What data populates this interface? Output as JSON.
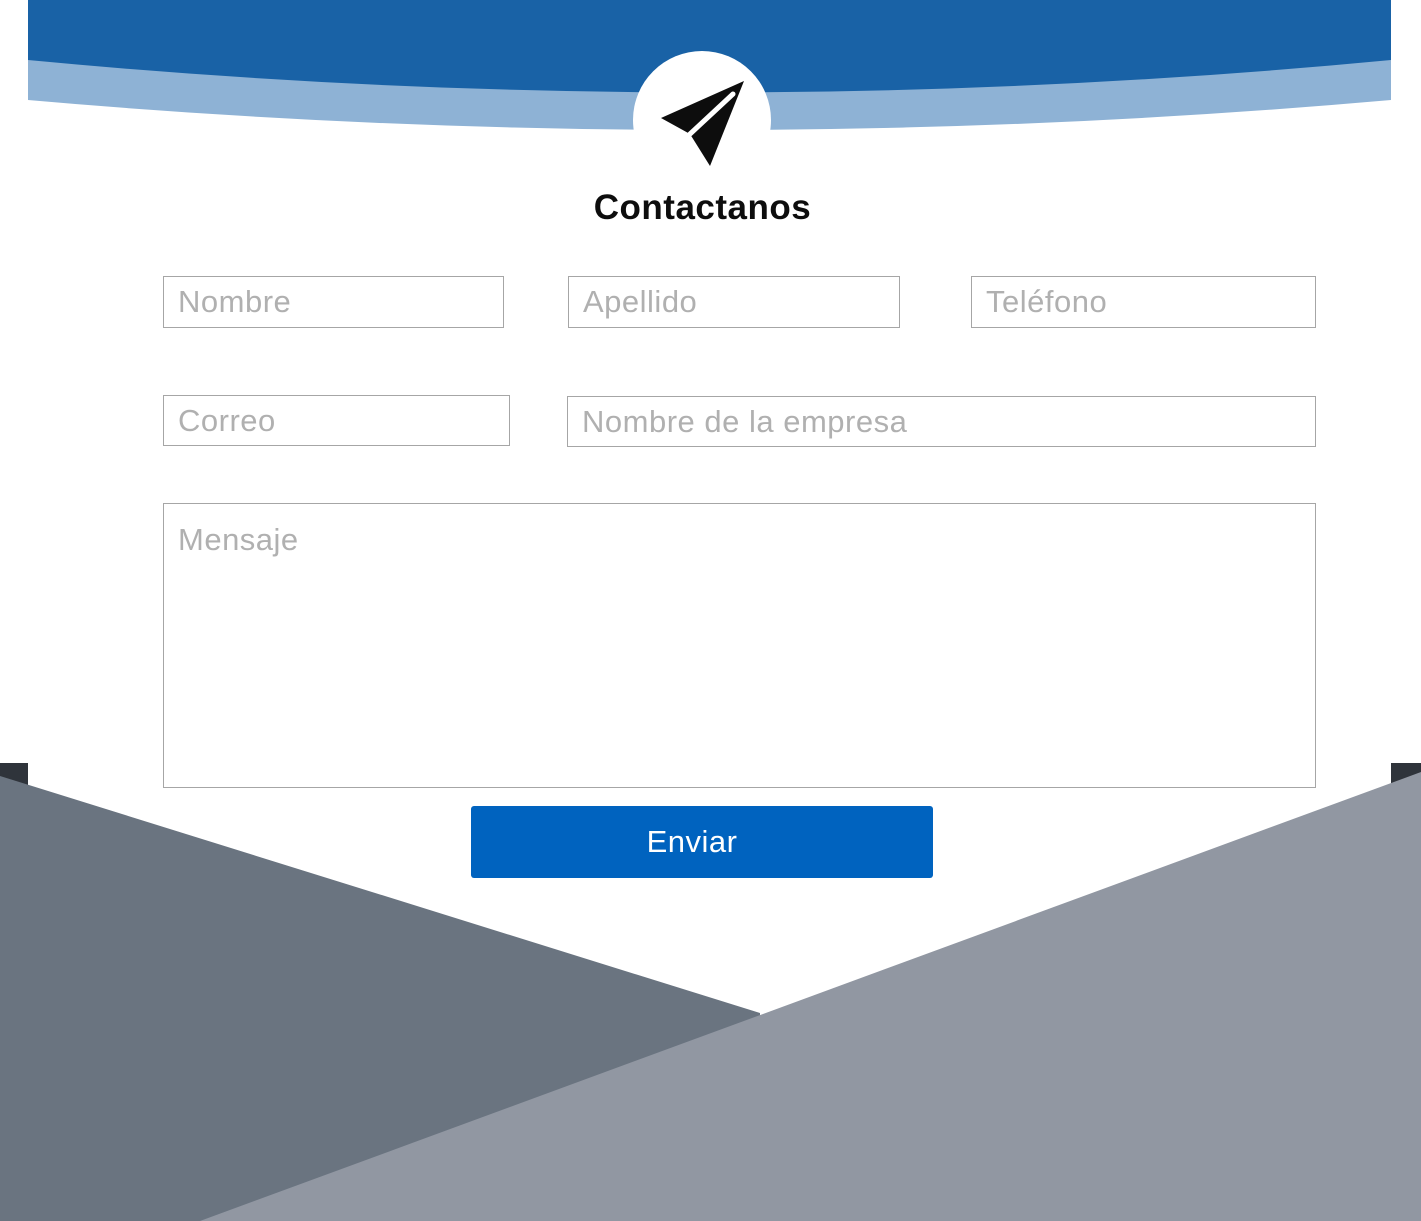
{
  "header": {
    "icon": "paper-plane-icon",
    "title": "Contactanos",
    "colors": {
      "band_dark": "#1962a6",
      "band_light": "#8eb2d5"
    }
  },
  "form": {
    "fields": {
      "nombre": {
        "placeholder": "Nombre",
        "value": ""
      },
      "apellido": {
        "placeholder": "Apellido",
        "value": ""
      },
      "telefono": {
        "placeholder": "Teléfono",
        "value": ""
      },
      "correo": {
        "placeholder": "Correo",
        "value": ""
      },
      "empresa": {
        "placeholder": "Nombre de la empresa",
        "value": ""
      },
      "mensaje": {
        "placeholder": "Mensaje",
        "value": ""
      }
    },
    "submit_label": "Enviar",
    "submit_color": "#0063bf"
  },
  "footer": {
    "colors": {
      "left_panel": "#6a7480",
      "right_panel": "#9197a2",
      "edge": "#2f343b"
    }
  }
}
